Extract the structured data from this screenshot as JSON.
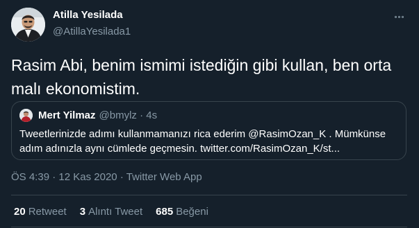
{
  "author": {
    "name": "Atilla Yesilada",
    "handle": "@AtillaYesilada1"
  },
  "tweet": {
    "text": "Rasim Abi, benim ismimi istediğin gibi kullan, ben orta malı ekonomistim."
  },
  "quoted_tweet": {
    "name": "Mert Yilmaz",
    "handle": "@bmylz",
    "separator": "·",
    "time": "4s",
    "text": "Tweetlerinizde adımı kullanmamanızı rica ederim @RasimOzan_K . Mümkünse adım adınızla aynı cümlede geçmesin. twitter.com/RasimOzan_K/st..."
  },
  "meta": {
    "time": "ÖS 4:39",
    "separator": "·",
    "date": "12 Kas 2020",
    "source": "Twitter Web App"
  },
  "stats": {
    "retweets_count": "20",
    "retweets_label": "Retweet",
    "quotes_count": "3",
    "quotes_label": "Alıntı Tweet",
    "likes_count": "685",
    "likes_label": "Beğeni"
  },
  "colors": {
    "background": "#15202b",
    "primary_text": "#ffffff",
    "secondary_text": "#8899a6",
    "border": "#38444d"
  }
}
